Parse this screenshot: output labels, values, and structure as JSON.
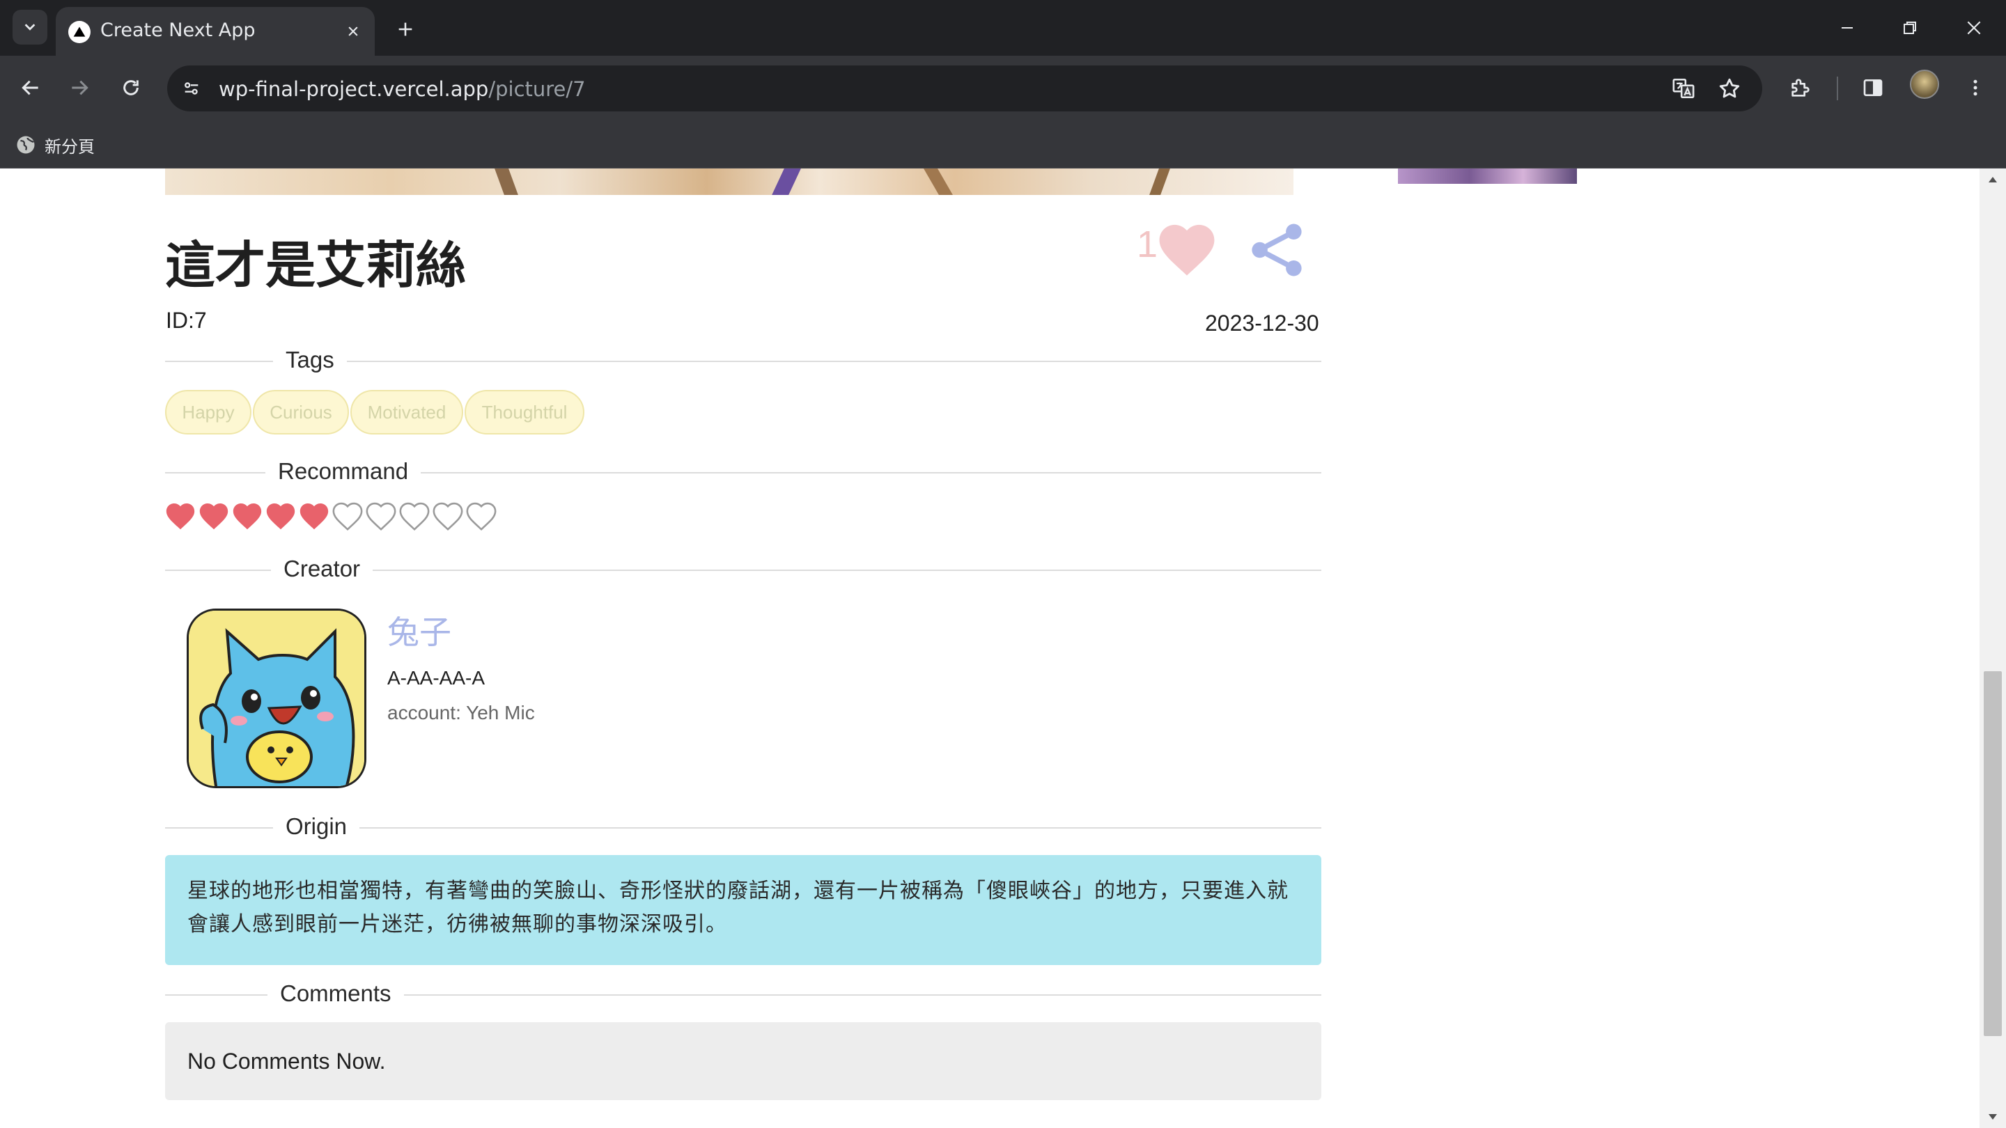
{
  "browser": {
    "tab_title": "Create Next App",
    "url_host": "wp-final-project.vercel.app",
    "url_path": "/picture/7",
    "bookmark_label": "新分頁"
  },
  "picture": {
    "title": "這才是艾莉絲",
    "like_count": "1",
    "id_label": "ID:7",
    "date": "2023-12-30"
  },
  "sections": {
    "tags": "Tags",
    "recommand": "Recommand",
    "creator": "Creator",
    "origin": "Origin",
    "comments": "Comments"
  },
  "tags": [
    "Happy",
    "Curious",
    "Motivated",
    "Thoughtful"
  ],
  "recommend": {
    "filled": 5,
    "total": 10
  },
  "creator": {
    "name": "兔子",
    "subtitle": "A-AA-AA-A",
    "account": "account: Yeh Mic"
  },
  "origin_text": "星球的地形也相當獨特，有著彎曲的笑臉山、奇形怪狀的廢話湖，還有一片被稱為「傻眼峽谷」的地方，只要進入就會讓人感到眼前一片迷茫，彷彿被無聊的事物深深吸引。",
  "comments_empty": "No Comments Now.",
  "colors": {
    "tag_bg": "#fdf7d2",
    "heart_filled": "#e8626b",
    "origin_bg": "#aee7f0",
    "accent_blue": "#a9b6e8"
  }
}
